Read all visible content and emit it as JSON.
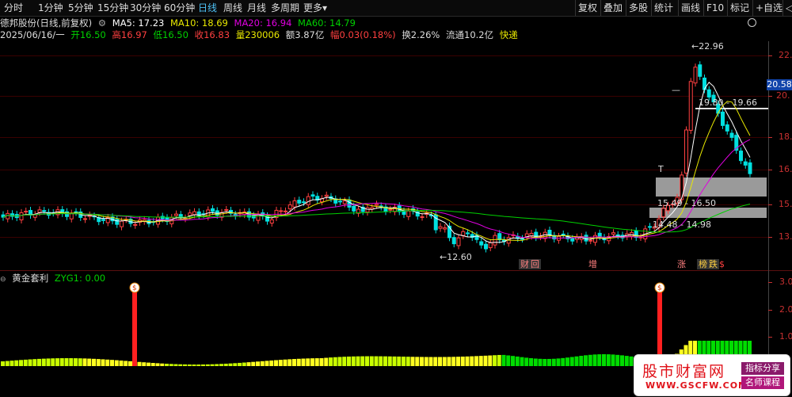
{
  "toolbar": {
    "periods": [
      "分时",
      "1分钟",
      "5分钟",
      "15分钟",
      "30分钟",
      "60分钟",
      "日线",
      "周线",
      "月线",
      "多周期",
      "更多"
    ],
    "active_period": "日线",
    "more_arrow": "▾",
    "right_items": [
      "复权",
      "叠加",
      "多股",
      "统计",
      "画线",
      "F10",
      "标记",
      "+自选",
      "◁"
    ]
  },
  "info": {
    "title": "德邦股份(日线,前复权)",
    "ma5": "MA5: 17.23",
    "ma10": "MA10: 18.69",
    "ma20": "MA20: 16.94",
    "ma60": "MA60: 14.79",
    "date": "2025/06/16/一",
    "open": "开16.50",
    "high": "高16.97",
    "low": "低16.50",
    "close": "收16.83",
    "volume": "量230006",
    "amount": "额3.87亿",
    "change": "幅0.03(0.18%)",
    "turnover": "换2.26%",
    "float_cap": "流通10.2亿",
    "tag": "快递",
    "colors": {
      "ma5": "#ffffff",
      "ma10": "#e8e800",
      "ma20": "#e000e0",
      "ma60": "#00d000",
      "up": "#ff4040",
      "down": "#00e0e0"
    }
  },
  "price_axis": {
    "labels": [
      "22.",
      "20.",
      "18.4",
      "16.8",
      "15.1",
      "13."
    ],
    "current": "20.58"
  },
  "annotations": {
    "high": "22.96",
    "low": "12.60",
    "level1": "19.80 - 19.66",
    "level2": "15.49 - 16.50",
    "level3": "14.48 - 14.98",
    "t_mark": "T",
    "dash_mark": "—"
  },
  "event_tags": [
    {
      "label": "财",
      "color": "#ff8080",
      "bg": "#333"
    },
    {
      "label": "回",
      "color": "#ff8080",
      "bg": "#333"
    },
    {
      "label": "增",
      "color": "#ff8080",
      "bg": "#000"
    },
    {
      "label": "涨",
      "color": "#ff8080",
      "bg": "#000"
    },
    {
      "label": "榜",
      "color": "#ffd040",
      "bg": "#333"
    },
    {
      "label": "跌",
      "color": "#ffd040",
      "bg": "#333"
    },
    {
      "label": "$",
      "color": "#ff4040",
      "bg": "#000"
    }
  ],
  "indicator": {
    "name": "黄金套利",
    "value": "ZYG1: 0.00",
    "axis_labels": [
      "3.0",
      "2.0",
      "1.0"
    ],
    "signal_icon": "money-bag-icon",
    "signal_count": 2
  },
  "watermark": {
    "brand": "股市财富网",
    "url": "WWW.GSCFW.COM",
    "tag1": "指标分享",
    "tag2": "名师课程"
  }
}
